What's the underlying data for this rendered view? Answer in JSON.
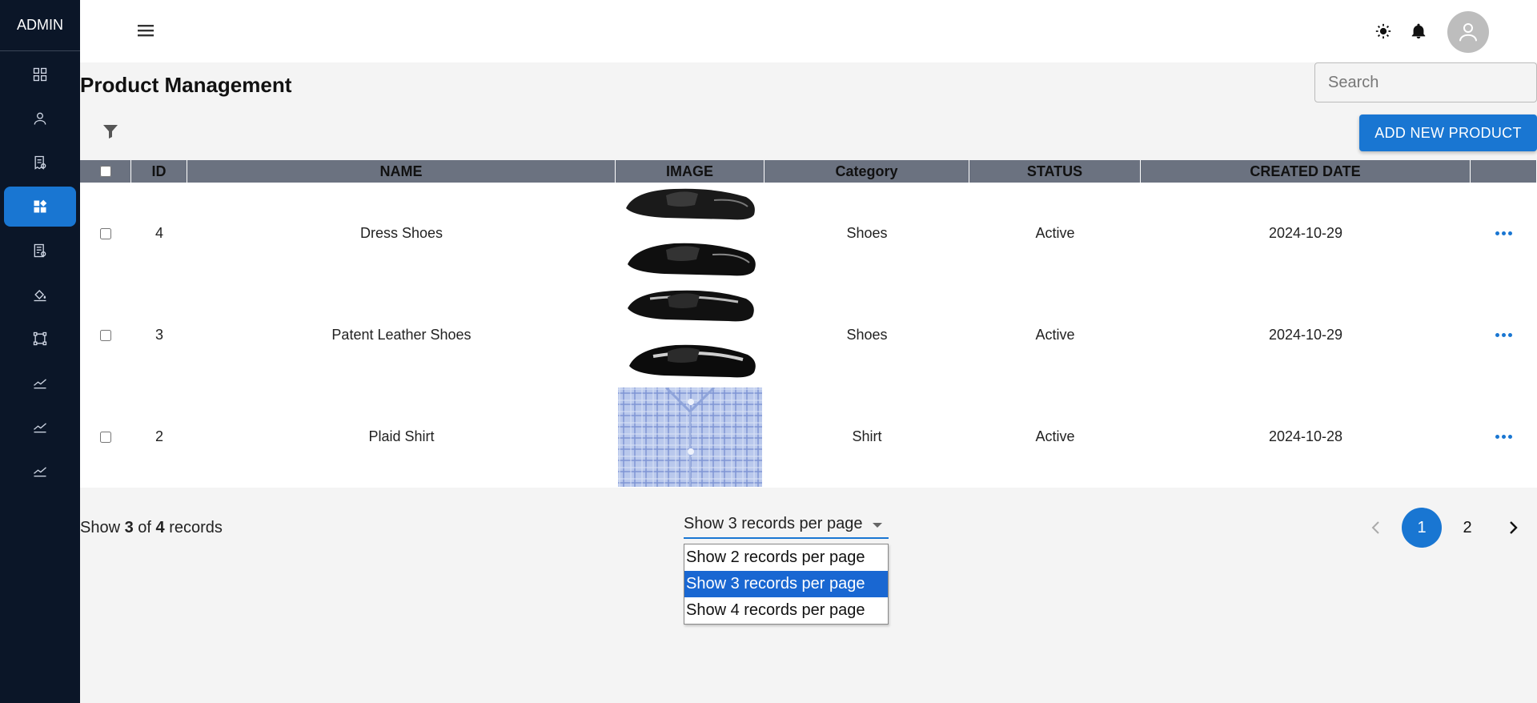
{
  "app": {
    "brand": "ADMIN"
  },
  "sidebar": {
    "items": [
      {
        "icon": "dashboard-icon",
        "active": false
      },
      {
        "icon": "user-icon",
        "active": false
      },
      {
        "icon": "receipt-icon",
        "active": false
      },
      {
        "icon": "widgets-icon",
        "active": true
      },
      {
        "icon": "order-list-icon",
        "active": false
      },
      {
        "icon": "paint-bucket-icon",
        "active": false
      },
      {
        "icon": "transform-icon",
        "active": false
      },
      {
        "icon": "chart-line-icon",
        "active": false
      },
      {
        "icon": "chart-line-icon",
        "active": false
      },
      {
        "icon": "chart-line-icon",
        "active": false
      }
    ]
  },
  "header": {
    "icons": [
      "menu-icon",
      "brightness-icon",
      "bell-icon",
      "avatar-icon"
    ]
  },
  "page": {
    "title": "Product Management",
    "search_placeholder": "Search",
    "add_button": "ADD NEW PRODUCT"
  },
  "table": {
    "headers": {
      "id": "ID",
      "name": "NAME",
      "image": "IMAGE",
      "category": "Category",
      "status": "STATUS",
      "created": "CREATED DATE"
    },
    "rows": [
      {
        "id": "4",
        "name": "Dress Shoes",
        "image": "dress-shoes-image",
        "category": "Shoes",
        "status": "Active",
        "created": "2024-10-29"
      },
      {
        "id": "3",
        "name": "Patent Leather Shoes",
        "image": "patent-shoes-image",
        "category": "Shoes",
        "status": "Active",
        "created": "2024-10-29"
      },
      {
        "id": "2",
        "name": "Plaid Shirt",
        "image": "plaid-shirt-image",
        "category": "Shirt",
        "status": "Active",
        "created": "2024-10-28"
      }
    ]
  },
  "footer": {
    "show_prefix": "Show",
    "shown": "3",
    "of_word": "of",
    "total": "4",
    "records_word": "records",
    "rpp_selected": "Show 3 records per page",
    "rpp_options": [
      "Show 2 records per page",
      "Show 3 records per page",
      "Show 4 records per page"
    ],
    "rpp_selected_index": 1,
    "pages": [
      "1",
      "2"
    ],
    "current_page": "1"
  },
  "colors": {
    "sidebar_bg": "#0b1628",
    "accent": "#1976d2",
    "header_row": "#6b7280"
  }
}
